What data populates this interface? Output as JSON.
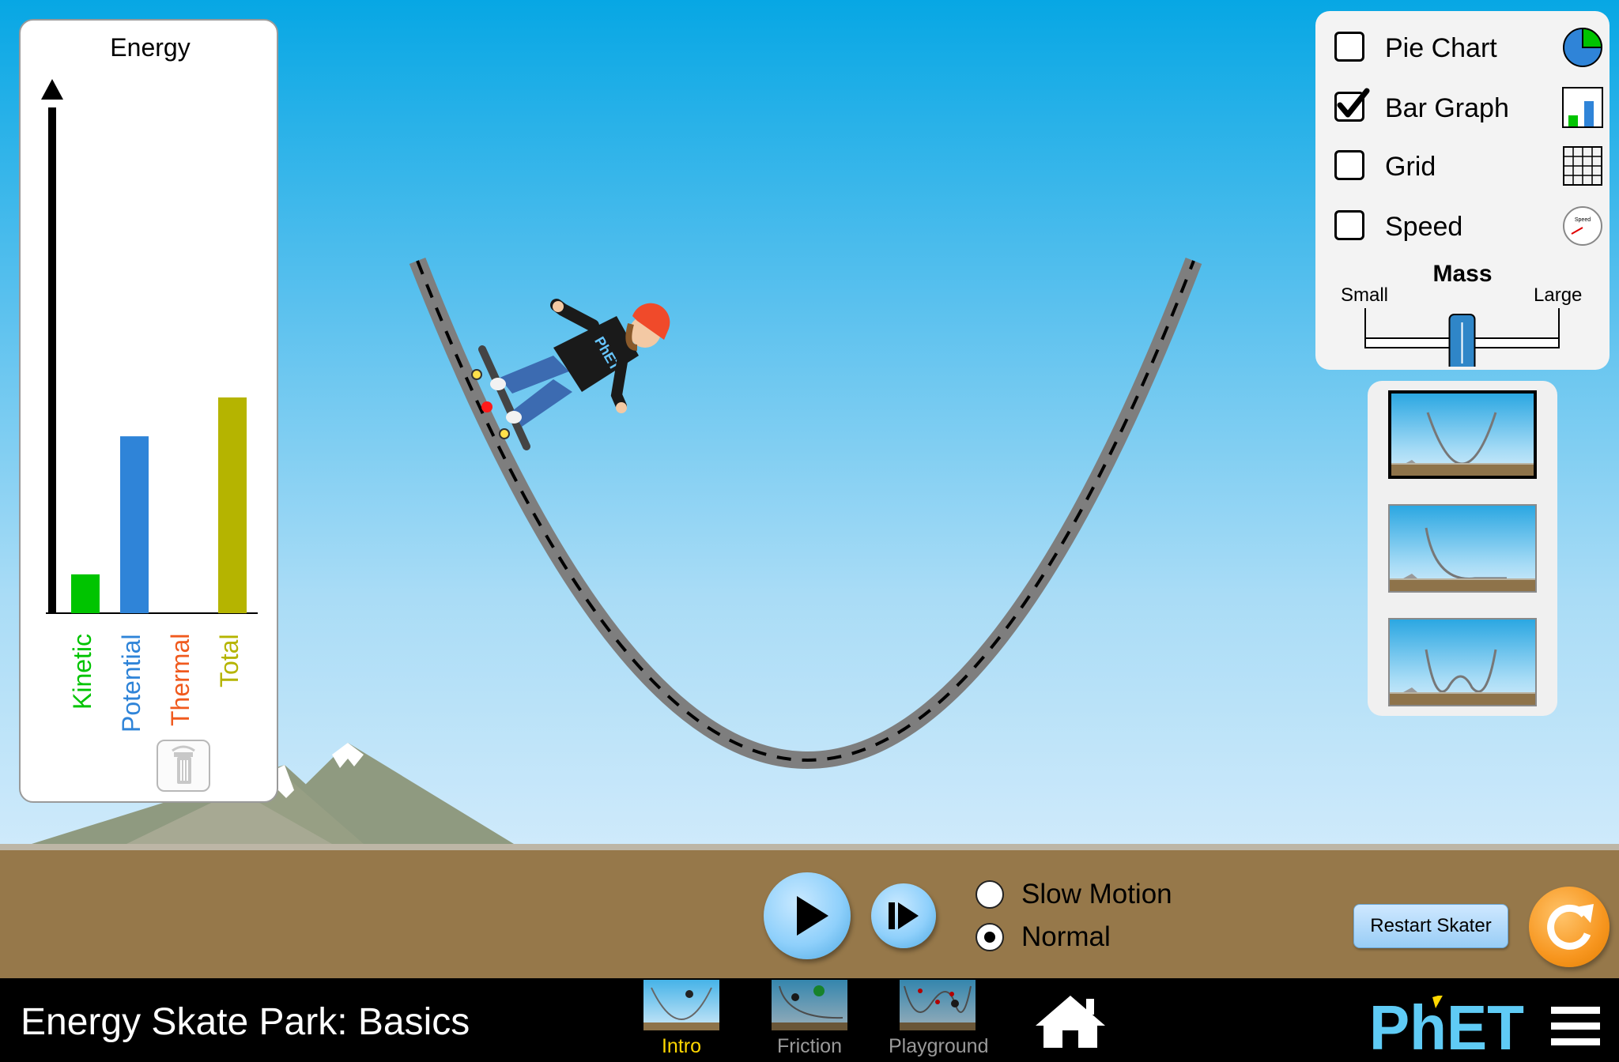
{
  "energy_panel": {
    "title": "Energy",
    "bars": [
      {
        "label": "Kinetic",
        "color": "#00c400",
        "value": 0.18
      },
      {
        "label": "Potential",
        "color": "#2f84d8",
        "value": 0.82
      },
      {
        "label": "Thermal",
        "color": "#f05a1e",
        "value": 0
      },
      {
        "label": "Total",
        "color": "#b5b400",
        "value": 1.0
      }
    ],
    "trash_icon": "trash-icon"
  },
  "options": {
    "items": [
      {
        "label": "Pie Chart",
        "checked": false,
        "icon": "pie-chart-icon"
      },
      {
        "label": "Bar Graph",
        "checked": true,
        "icon": "bar-graph-icon"
      },
      {
        "label": "Grid",
        "checked": false,
        "icon": "grid-icon"
      },
      {
        "label": "Speed",
        "checked": false,
        "icon": "speedometer-icon"
      }
    ],
    "speed_icon_text": "Speed",
    "mass": {
      "title": "Mass",
      "min_label": "Small",
      "max_label": "Large",
      "value": 0.5
    }
  },
  "tracks": {
    "selected": 0,
    "items": [
      "parabola-track",
      "ramp-track",
      "double-well-track"
    ]
  },
  "playback": {
    "playing": false,
    "speeds": [
      {
        "label": "Slow Motion",
        "selected": false
      },
      {
        "label": "Normal",
        "selected": true
      }
    ]
  },
  "restart_skater_label": "Restart Skater",
  "navbar": {
    "title": "Energy Skate Park: Basics",
    "screens": [
      {
        "label": "Intro",
        "active": true
      },
      {
        "label": "Friction",
        "active": false
      },
      {
        "label": "Playground",
        "active": false
      }
    ],
    "logo_text": "PhET",
    "skater_shirt_text": "PhET"
  },
  "colors": {
    "active_tab": "#ffd700",
    "inactive_tab": "#9a9a9a",
    "track": "#7e7e7e",
    "reset_orange": "#f7961f"
  }
}
